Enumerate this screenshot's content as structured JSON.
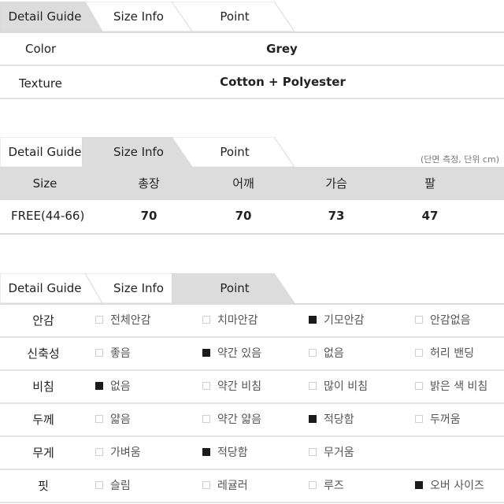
{
  "tabs": [
    "Detail Guide",
    "Size Info",
    "Point"
  ],
  "detail_guide": {
    "active_tab": 0,
    "rows": [
      {
        "label": "Color",
        "value": "Grey"
      },
      {
        "label": "Texture",
        "value": "Cotton + Polyester"
      }
    ]
  },
  "size_info": {
    "active_tab": 1,
    "note": "(단면 측정, 단위 cm)",
    "headers": [
      "Size",
      "총장",
      "어깨",
      "가슴",
      "팔"
    ],
    "rows": [
      {
        "size": "FREE(44-66)",
        "values": [
          "70",
          "70",
          "73",
          "47"
        ]
      }
    ]
  },
  "point": {
    "active_tab": 2,
    "rows": [
      {
        "label": "안감",
        "options": [
          {
            "text": "전체안감",
            "checked": false
          },
          {
            "text": "치마안감",
            "checked": false
          },
          {
            "text": "기모안감",
            "checked": true
          },
          {
            "text": "안감없음",
            "checked": false
          }
        ]
      },
      {
        "label": "신축성",
        "options": [
          {
            "text": "좋음",
            "checked": false
          },
          {
            "text": "약간 있음",
            "checked": true
          },
          {
            "text": "없음",
            "checked": false
          },
          {
            "text": "허리 밴딩",
            "checked": false
          }
        ]
      },
      {
        "label": "비침",
        "options": [
          {
            "text": "없음",
            "checked": true
          },
          {
            "text": "약간 비침",
            "checked": false
          },
          {
            "text": "많이 비침",
            "checked": false
          },
          {
            "text": "밝은 색 비침",
            "checked": false
          }
        ]
      },
      {
        "label": "두께",
        "options": [
          {
            "text": "얇음",
            "checked": false
          },
          {
            "text": "약간 얇음",
            "checked": false
          },
          {
            "text": "적당함",
            "checked": true
          },
          {
            "text": "두꺼움",
            "checked": false
          }
        ]
      },
      {
        "label": "무게",
        "options": [
          {
            "text": "가벼움",
            "checked": false
          },
          {
            "text": "적당함",
            "checked": true
          },
          {
            "text": "무거움",
            "checked": false
          }
        ]
      },
      {
        "label": "핏",
        "options": [
          {
            "text": "슬림",
            "checked": false
          },
          {
            "text": "레귤러",
            "checked": false
          },
          {
            "text": "루즈",
            "checked": false
          },
          {
            "text": "오버 사이즈",
            "checked": true
          }
        ]
      }
    ]
  },
  "colors": {
    "active_tab_bg": "#dcdcdc",
    "checked_box": "#1a1a1a",
    "unchecked_box_border": "#cfcfcf"
  }
}
